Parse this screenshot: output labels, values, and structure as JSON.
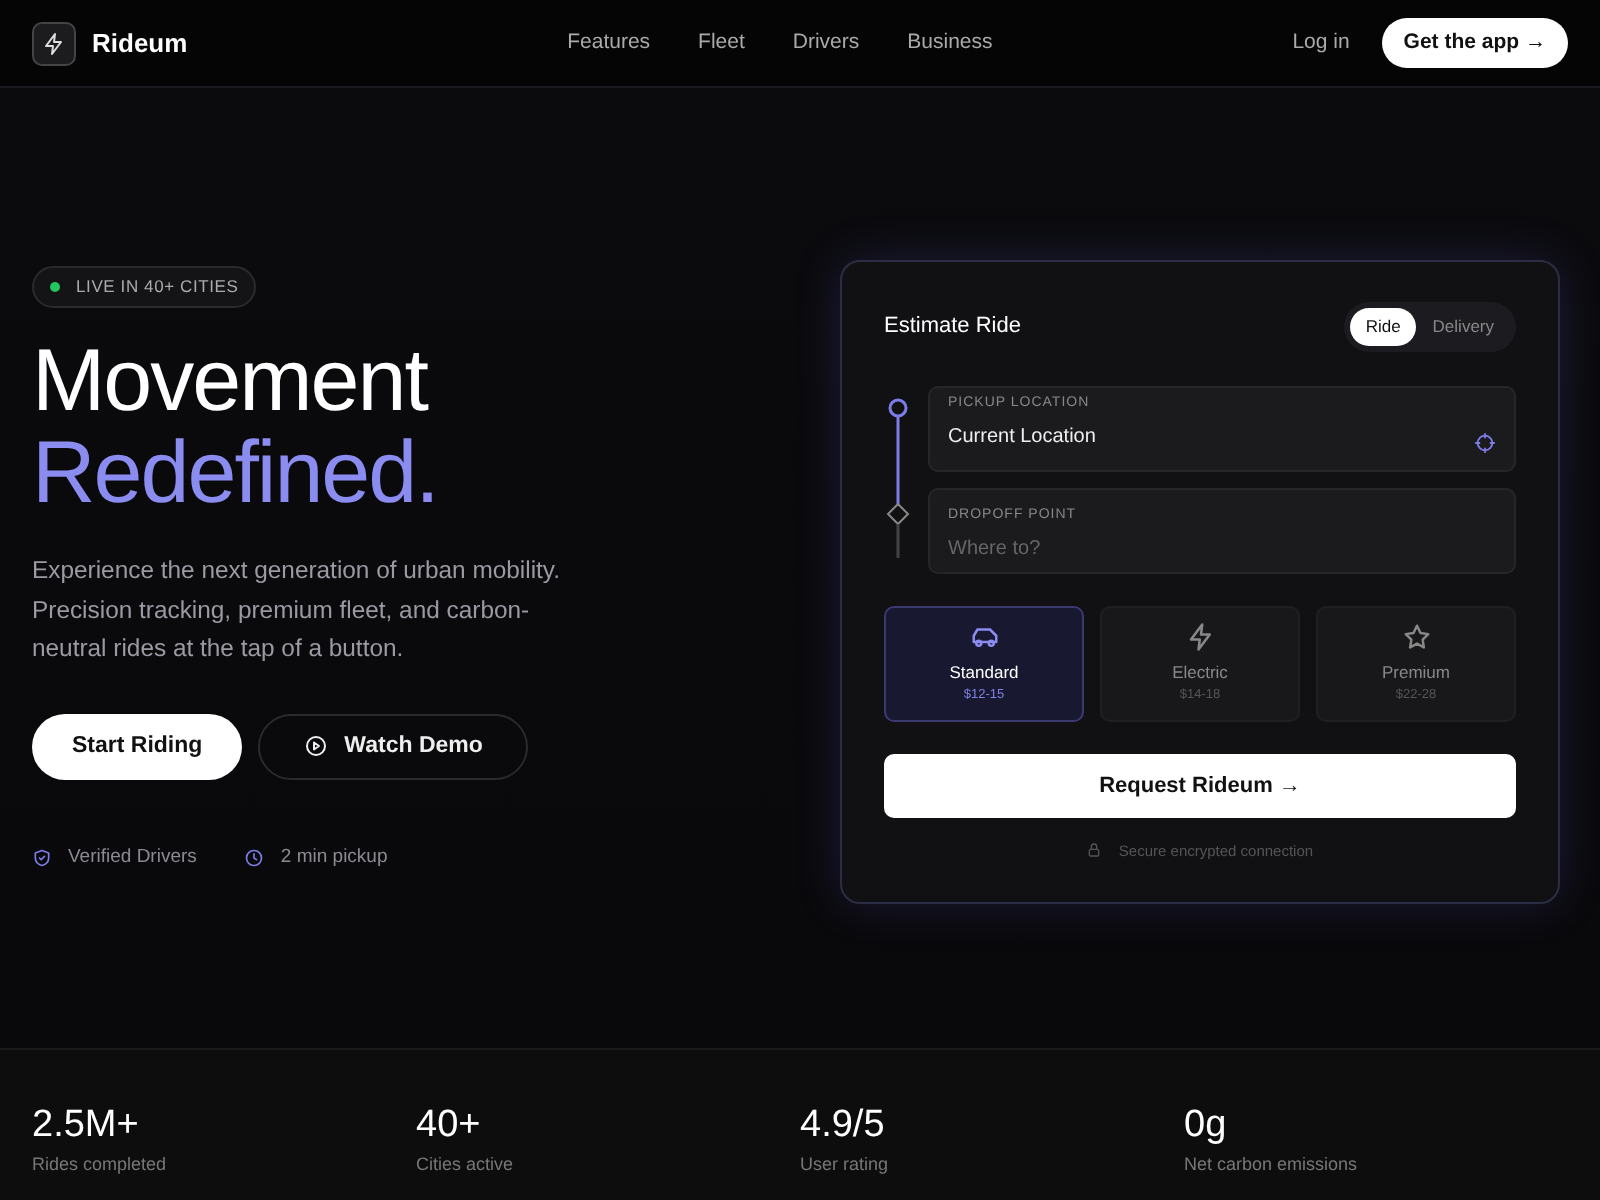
{
  "navbar": {
    "brand": "Rideum",
    "links": [
      "Features",
      "Fleet",
      "Drivers",
      "Business"
    ],
    "login": "Log in",
    "cta": "Get the app",
    "cta_arrow": "→"
  },
  "hero": {
    "badge": "LIVE IN 40+ CITIES",
    "title_line1": "Movement",
    "title_line2": "Redefined.",
    "description": "Experience the next generation of urban mobility. Precision tracking, premium fleet, and carbon-neutral rides at the tap of a button.",
    "primary_button": "Start Riding",
    "secondary_button": "Watch Demo",
    "features": [
      {
        "kind": "shield",
        "label": "Verified Drivers"
      },
      {
        "kind": "clock",
        "label": "2 min pickup"
      }
    ]
  },
  "estimate": {
    "title": "Estimate Ride",
    "tabs": [
      {
        "label": "Ride",
        "selected": true
      },
      {
        "label": "Delivery",
        "selected": false
      }
    ],
    "pickup": {
      "label": "PICKUP LOCATION",
      "value": "Current Location"
    },
    "dropoff": {
      "label": "DROPOFF POINT",
      "placeholder": "Where to?"
    },
    "options": [
      {
        "kind": "car",
        "name": "Standard",
        "price": "$12-15",
        "selected": true
      },
      {
        "kind": "bolt",
        "name": "Electric",
        "price": "$14-18",
        "selected": false
      },
      {
        "kind": "star",
        "name": "Premium",
        "price": "$22-28",
        "selected": false
      }
    ],
    "button": "Request Rideum",
    "button_arrow": "→",
    "note": "Secure encrypted connection"
  },
  "stats": [
    {
      "value": "2.5M+",
      "label": "Rides completed"
    },
    {
      "value": "40+",
      "label": "Cities active"
    },
    {
      "value": "4.9/5",
      "label": "User rating"
    },
    {
      "value": "0g",
      "label": "Net carbon emissions"
    }
  ]
}
